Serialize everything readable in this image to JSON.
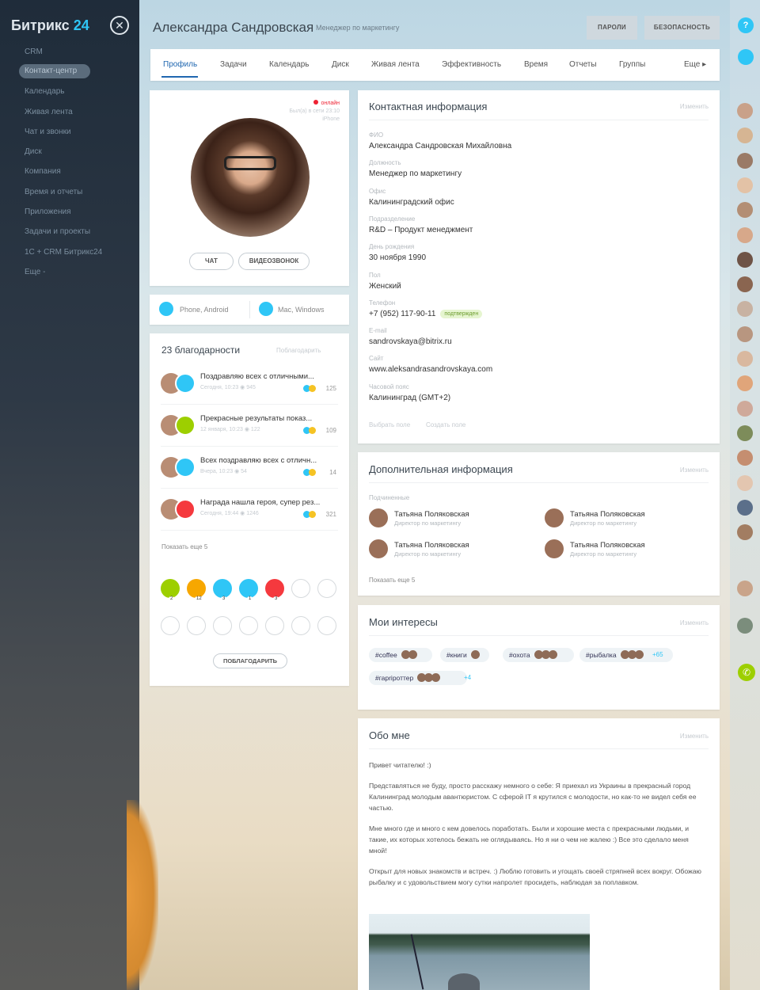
{
  "app": {
    "logo_a": "Битрикс",
    "logo_b": "24"
  },
  "sidebar": {
    "items": [
      "CRM",
      "Контакт-центр",
      "Календарь",
      "Живая лента",
      "Чат и звонки",
      "Диск",
      "Компания",
      "Время и отчеты",
      "Приложения",
      "Задачи и проекты",
      "1С + CRM Битрикс24",
      "Еще -"
    ],
    "active_index": 1
  },
  "header": {
    "name": "Александра Сандровская",
    "role": "Менеджер по маркетингу",
    "btn_passwords": "ПАРОЛИ",
    "btn_security": "БЕЗОПАСНОСТЬ"
  },
  "tabs": [
    "Профиль",
    "Задачи",
    "Календарь",
    "Диск",
    "Живая лента",
    "Эффективность",
    "Время",
    "Отчеты",
    "Группы",
    "Еще ▸"
  ],
  "profile": {
    "status": "онлайн",
    "last_seen": "Был(а) в сети 23:10",
    "device": "iPhone",
    "chat": "ЧАТ",
    "video": "ВИДЕОЗВОНОК"
  },
  "apps": {
    "mobile": "Phone, Android",
    "desktop": "Mac, Windows"
  },
  "thanks": {
    "title": "23 благодарности",
    "action": "Поблагодарить",
    "items": [
      {
        "text": "Поздравляю всех с отличными...",
        "meta": "Сегодня, 10:23   ◉ 945",
        "count": "125",
        "accent": "#2fc6f6"
      },
      {
        "text": "Прекрасные результаты показ...",
        "meta": "12 января, 10:23   ◉ 122",
        "count": "109",
        "accent": "#9dcf00"
      },
      {
        "text": "Всех поздравляю всех с отличн...",
        "meta": "Вчера, 10:23   ◉ 54",
        "count": "14",
        "accent": "#2fc6f6"
      },
      {
        "text": "Награда нашла героя, супер рез...",
        "meta": "Сегодня, 19:44   ◉ 1246",
        "count": "321",
        "accent": "#f5393e"
      }
    ],
    "more": "Показать еще 5",
    "badge_counts": [
      "2",
      "12",
      "3",
      "1",
      "3"
    ],
    "button": "ПОБЛАГОДАРИТЬ"
  },
  "contact": {
    "title": "Контактная информация",
    "edit": "Изменить",
    "fields": [
      {
        "label": "ФИО",
        "value": "Александра Сандровская Михайловна"
      },
      {
        "label": "Должность",
        "value": "Менеджер по маркетингу"
      },
      {
        "label": "Офис",
        "value": "Калининградский офис"
      },
      {
        "label": "Подразделение",
        "value": "R&D – Продукт менеджмент"
      },
      {
        "label": "День рождения",
        "value": "30 ноября 1990"
      },
      {
        "label": "Пол",
        "value": "Женский"
      },
      {
        "label": "Телефон",
        "value": "+7 (952) 117-90-11"
      },
      {
        "label": "E-mail",
        "value": "sandrovskaya@bitrix.ru"
      },
      {
        "label": "Сайт",
        "value": "www.aleksandrasandrovskaya.com"
      },
      {
        "label": "Часовой пояс",
        "value": "Калининград (GMT+2)"
      }
    ],
    "phone_badge": "подтвержден",
    "link_select": "Выбрать поле",
    "link_create": "Создать поле"
  },
  "additional": {
    "title": "Дополнительная информация",
    "edit": "Изменить",
    "label": "Подчиненные",
    "people": [
      {
        "name": "Татьяна Поляковская",
        "role": "Директор по маркетингу"
      },
      {
        "name": "Татьяна Поляковская",
        "role": "Директор по маркетингу"
      },
      {
        "name": "Татьяна Поляковская",
        "role": "Директор по маркетингу"
      },
      {
        "name": "Татьяна Поляковская",
        "role": "Директор по маркетингу"
      }
    ],
    "more": "Показать еще 5"
  },
  "interests": {
    "title": "Мои интересы",
    "edit": "Изменить",
    "tags": [
      "#coffee",
      "#книги",
      "#охота",
      "#рыбалка",
      "#гарripоттер"
    ],
    "extra1": "+65",
    "extra2": "+4"
  },
  "about": {
    "title": "Обо мне",
    "edit": "Изменить",
    "paragraphs": [
      "Привет читателю! :)",
      "Представляться не буду, просто расскажу немного о себе: Я приехал из Украины в прекрасный город Калининград молодым авантюристом. С сферой IT я крутился с молодости, но как-то не видел себя ее частью.",
      "Мне много где и много с кем довелось поработать. Были и хорошие места с прекрасными людьми, и такие, их которых хотелось бежать не оглядываясь. Но я ни о чем не жалею :) Все это сделало меня мной!",
      "Открыт для новых знакомств и встреч. :) Люблю готовить и угощать своей стряпней всех вокруг. Обожаю рыбалку и с удовольствием могу сутки напролет просидеть, наблюдая за поплавком."
    ]
  },
  "colors": {
    "accent": "#2067b0",
    "brand": "#2fc6f6"
  }
}
